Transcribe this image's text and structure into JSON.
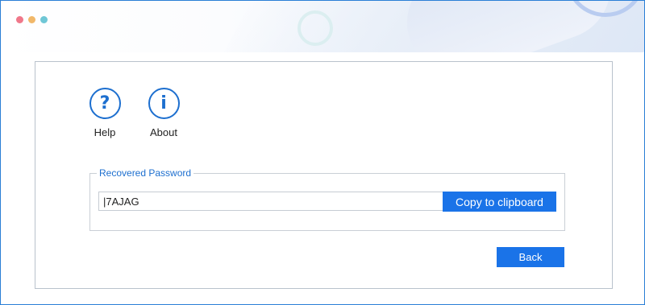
{
  "window": {
    "controls": [
      "red-dot",
      "yellow-dot",
      "teal-dot"
    ]
  },
  "toolbar": {
    "help": {
      "label": "Help",
      "icon": "question-icon",
      "glyph": "?"
    },
    "about": {
      "label": "About",
      "icon": "info-icon",
      "glyph": "i"
    }
  },
  "recovered": {
    "legend": "Recovered Password",
    "password": "|7AJAG",
    "copy_label": "Copy to clipboard"
  },
  "footer": {
    "back_label": "Back"
  },
  "colors": {
    "accent": "#1a73e8",
    "icon_blue": "#1d6fcf",
    "window_border": "#2a7fd6",
    "dot_red": "#f0788a",
    "dot_yellow": "#f1b86a",
    "dot_teal": "#6fc7d6"
  }
}
